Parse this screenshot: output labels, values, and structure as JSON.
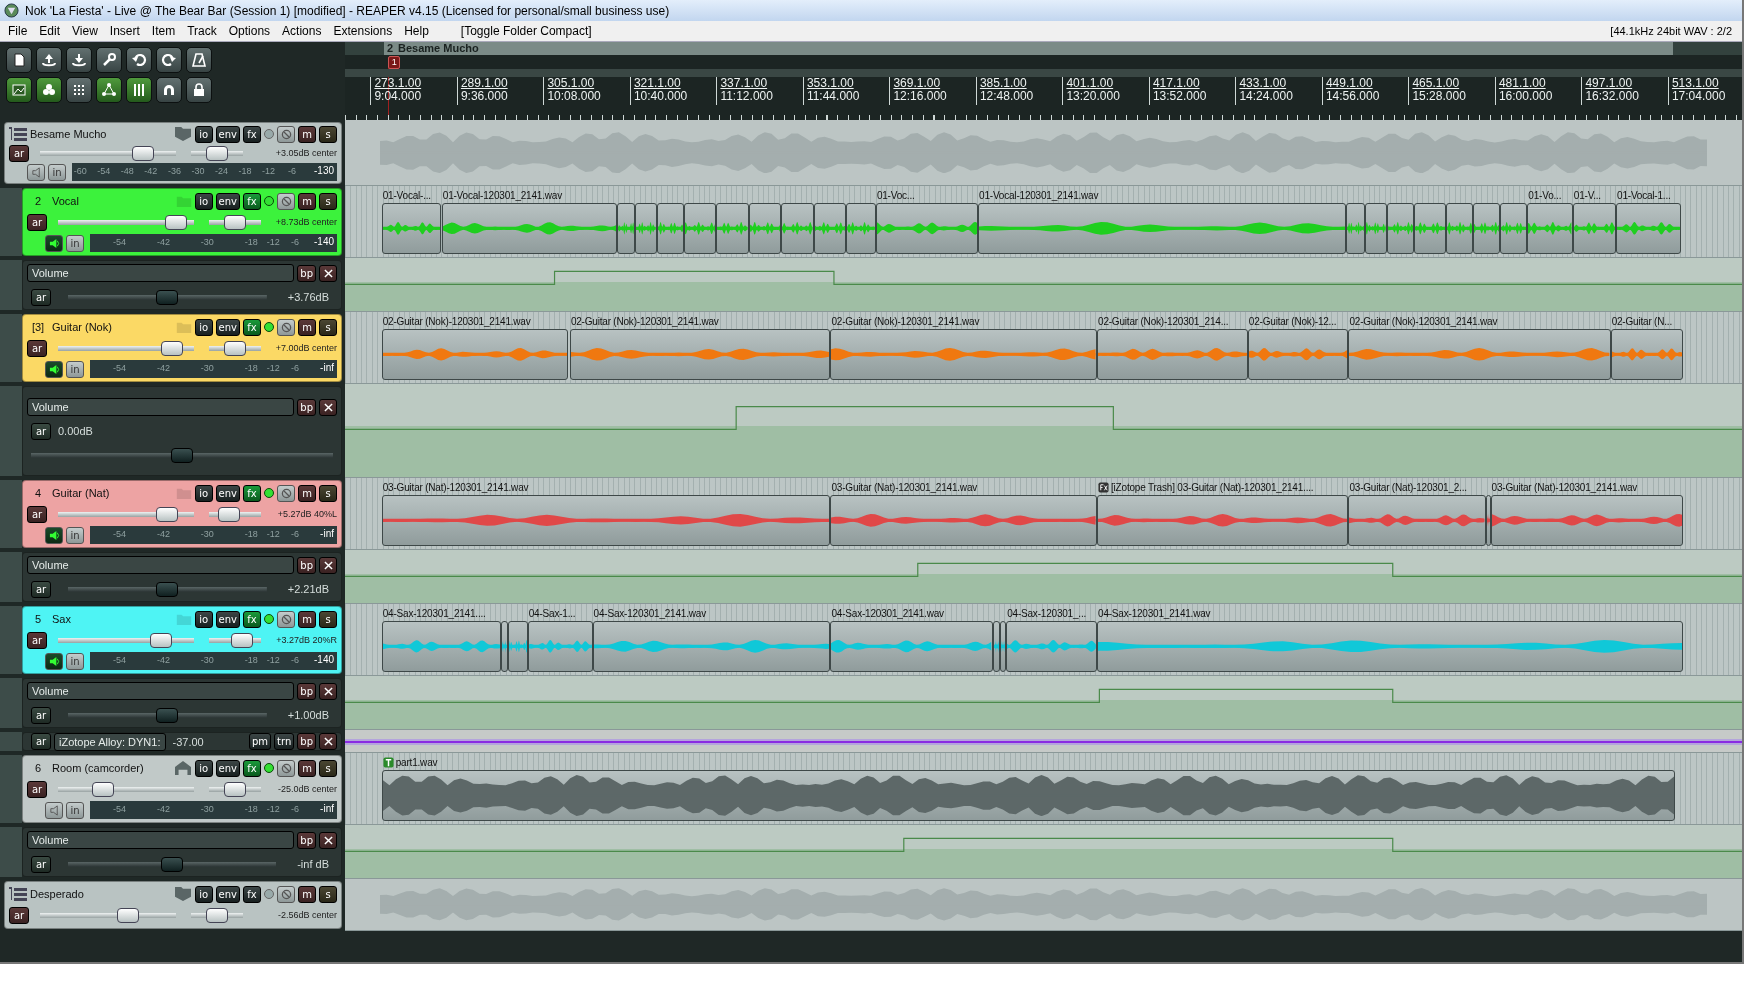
{
  "window": {
    "title": "Nok 'La Fiesta' - Live @ The Bear Bar (Session 1) [modified] - REAPER v4.15 (Licensed for personal/small business use)"
  },
  "menu": [
    {
      "label": "File"
    },
    {
      "label": "Edit"
    },
    {
      "label": "View"
    },
    {
      "label": "Insert"
    },
    {
      "label": "Item"
    },
    {
      "label": "Track"
    },
    {
      "label": "Options"
    },
    {
      "label": "Actions"
    },
    {
      "label": "Extensions"
    },
    {
      "label": "Help"
    },
    {
      "label": "[Toggle Folder Compact]"
    }
  ],
  "status": "[44.1kHz 24bit WAV : 2/2",
  "toolbar": [
    {
      "on": false
    },
    {
      "on": false
    },
    {
      "on": false
    },
    {
      "on": false
    },
    {
      "on": false
    },
    {
      "on": false
    },
    {
      "on": false
    },
    {
      "on": true
    },
    {
      "on": true
    },
    {
      "on": false
    },
    {
      "on": true
    },
    {
      "on": true
    },
    {
      "on": false
    },
    {
      "on": false
    }
  ],
  "ruler": {
    "region": {
      "number": "2",
      "name": "Besame Mucho"
    },
    "marker": {
      "label": "1"
    },
    "ticks": [
      {
        "bar": "273.1.00",
        "time": "9:04.000"
      },
      {
        "bar": "289.1.00",
        "time": "9:36.000"
      },
      {
        "bar": "305.1.00",
        "time": "10:08.000"
      },
      {
        "bar": "321.1.00",
        "time": "10:40.000"
      },
      {
        "bar": "337.1.00",
        "time": "11:12.000"
      },
      {
        "bar": "353.1.00",
        "time": "11:44.000"
      },
      {
        "bar": "369.1.00",
        "time": "12:16.000"
      },
      {
        "bar": "385.1.00",
        "time": "12:48.000"
      },
      {
        "bar": "401.1.00",
        "time": "13:20.000"
      },
      {
        "bar": "417.1.00",
        "time": "13:52.000"
      },
      {
        "bar": "433.1.00",
        "time": "14:24.000"
      },
      {
        "bar": "449.1.00",
        "time": "14:56.000"
      },
      {
        "bar": "465.1.00",
        "time": "15:28.000"
      },
      {
        "bar": "481.1.00",
        "time": "16:00.000"
      },
      {
        "bar": "497.1.00",
        "time": "16:32.000"
      },
      {
        "bar": "513.1.00",
        "time": "17:04.000"
      }
    ]
  },
  "tracks": [
    {
      "kind": "folder",
      "name": "Besame Mucho",
      "color": "#b9c3c2",
      "fx_active": false,
      "monitor": false,
      "volume": {
        "level": 0.76
      },
      "pan": {
        "level": 0.5
      },
      "readout": "+3.05dB center",
      "controls": {
        "arm": "ar",
        "io": "io",
        "env": "env",
        "fx": "fx",
        "mute": "m",
        "solo": "s",
        "input": "in"
      },
      "meter": {
        "scale": [
          "-60",
          "-54",
          "-48",
          "-42",
          "-36",
          "-30",
          "-24",
          "-18",
          "-12",
          "-6"
        ],
        "peak": "-130"
      },
      "children": [
        {
          "kind": "track",
          "number": "2",
          "name": "Vocal",
          "color": "#3cf23c",
          "fx_active": true,
          "monitor": true,
          "volume": {
            "level": 0.87
          },
          "pan": {
            "level": 0.5
          },
          "readout": "+8.73dB center",
          "controls": {
            "arm": "ar",
            "io": "io",
            "env": "env",
            "fx": "fx",
            "mute": "m",
            "solo": "s",
            "input": "in"
          },
          "meter": {
            "scale": [
              "-54",
              "-42",
              "-30",
              "-18",
              "-12",
              "-6"
            ],
            "peak": "-140"
          },
          "items": [
            {
              "kind": "audio",
              "label": "01-Vocal-..."
            },
            {
              "kind": "audio",
              "label": "01-Vocal-120301_2141.wav"
            },
            {
              "kind": "audio"
            },
            {
              "kind": "audio"
            },
            {
              "kind": "audio"
            },
            {
              "kind": "audio"
            },
            {
              "kind": "audio"
            },
            {
              "kind": "audio"
            },
            {
              "kind": "audio"
            },
            {
              "kind": "audio"
            },
            {
              "kind": "audio"
            },
            {
              "kind": "audio",
              "label": "01-Voc..."
            },
            {
              "kind": "audio",
              "label": "01-Vocal-120301_2141.wav"
            },
            {
              "kind": "audio"
            },
            {
              "kind": "audio"
            },
            {
              "kind": "audio"
            },
            {
              "kind": "audio"
            },
            {
              "kind": "audio"
            },
            {
              "kind": "audio"
            },
            {
              "kind": "audio"
            },
            {
              "kind": "audio",
              "label": "01-Vo..."
            },
            {
              "kind": "audio",
              "label": "01-V..."
            },
            {
              "kind": "audio",
              "label": "01-Vocal-1..."
            }
          ],
          "envelopes": [
            {
              "kind": "fader",
              "name": "Volume",
              "value": "+3.76dB",
              "level": 0.5,
              "controls": {
                "arm": "ar",
                "bypass": "bp"
              }
            }
          ]
        },
        {
          "kind": "track",
          "number": "[3]",
          "name": "Guitar (Nok)",
          "color": "#fbd965",
          "fx_active": true,
          "monitor": true,
          "volume": {
            "level": 0.84
          },
          "pan": {
            "level": 0.5
          },
          "readout": "+7.00dB center",
          "controls": {
            "arm": "ar",
            "io": "io",
            "env": "env",
            "fx": "fx",
            "mute": "m",
            "solo": "s",
            "input": "in"
          },
          "meter": {
            "scale": [
              "-54",
              "-42",
              "-30",
              "-18",
              "-12",
              "-6"
            ],
            "peak": "-inf"
          },
          "items": [
            {
              "kind": "audio",
              "label": "02-Guitar (Nok)-120301_2141.wav"
            },
            {
              "kind": "audio",
              "label": "02-Guitar (Nok)-120301_2141.wav"
            },
            {
              "kind": "audio",
              "label": "02-Guitar (Nok)-120301_2141.wav"
            },
            {
              "kind": "audio",
              "label": "02-Guitar (Nok)-120301_214..."
            },
            {
              "kind": "audio",
              "label": "02-Guitar (Nok)-12..."
            },
            {
              "kind": "audio",
              "label": "02-Guitar (Nok)-120301_2141.wav"
            },
            {
              "kind": "audio",
              "label": "02-Guitar (N..."
            }
          ],
          "envelopes": [
            {
              "kind": "fader_tall",
              "name": "Volume",
              "value": "0.00dB",
              "level": 0.5,
              "controls": {
                "arm": "ar",
                "bypass": "bp"
              }
            }
          ]
        },
        {
          "kind": "track",
          "number": "4",
          "name": "Guitar (Nat)",
          "color": "#eda3a3",
          "fx_active": true,
          "monitor": true,
          "volume": {
            "level": 0.8
          },
          "pan": {
            "level": 0.38
          },
          "readout": "+5.27dB 40%L",
          "controls": {
            "arm": "ar",
            "io": "io",
            "env": "env",
            "fx": "fx",
            "mute": "m",
            "solo": "s",
            "input": "in"
          },
          "meter": {
            "scale": [
              "-54",
              "-42",
              "-30",
              "-18",
              "-12",
              "-6"
            ],
            "peak": "-inf"
          },
          "items": [
            {
              "kind": "audio",
              "label": "03-Guitar (Nat)-120301_2141.wav"
            },
            {
              "kind": "audio",
              "label": "03-Guitar (Nat)-120301_2141.wav"
            },
            {
              "kind": "fx",
              "label": "[iZotope Trash] 03-Guitar (Nat)-120301_2141...."
            },
            {
              "kind": "audio",
              "label": "03-Guitar (Nat)-120301_2..."
            },
            {
              "kind": "audio"
            },
            {
              "kind": "audio",
              "label": "03-Guitar (Nat)-120301_2141.wav"
            }
          ],
          "envelopes": [
            {
              "kind": "fader",
              "name": "Volume",
              "value": "+2.21dB",
              "level": 0.5,
              "controls": {
                "arm": "ar",
                "bypass": "bp"
              }
            }
          ]
        },
        {
          "kind": "track",
          "number": "5",
          "name": "Sax",
          "color": "#4ef4f4",
          "fx_active": true,
          "monitor": true,
          "volume": {
            "level": 0.76
          },
          "pan": {
            "level": 0.63
          },
          "readout": "+3.27dB 20%R",
          "controls": {
            "arm": "ar",
            "io": "io",
            "env": "env",
            "fx": "fx",
            "mute": "m",
            "solo": "s",
            "input": "in"
          },
          "meter": {
            "scale": [
              "-54",
              "-42",
              "-30",
              "-18",
              "-12",
              "-6"
            ],
            "peak": "-140"
          },
          "items": [
            {
              "kind": "audio",
              "label": "04-Sax-120301_2141...."
            },
            {
              "kind": "audio"
            },
            {
              "kind": "audio"
            },
            {
              "kind": "audio",
              "label": "04-Sax-1..."
            },
            {
              "kind": "audio",
              "label": "04-Sax-120301_2141.wav"
            },
            {
              "kind": "audio",
              "label": "04-Sax-120301_2141.wav"
            },
            {
              "kind": "audio"
            },
            {
              "kind": "audio"
            },
            {
              "kind": "audio",
              "label": "04-Sax-120301_..."
            },
            {
              "kind": "audio",
              "label": "04-Sax-120301_2141.wav"
            }
          ],
          "envelopes": [
            {
              "kind": "fader",
              "name": "Volume",
              "value": "+1.00dB",
              "level": 0.5,
              "controls": {
                "arm": "ar",
                "bypass": "bp"
              }
            },
            {
              "kind": "fx_param",
              "name": "iZotope Alloy: DYN1:",
              "value": "-37.00",
              "controls": {
                "arm": "ar",
                "mode": "pm",
                "learn": "trn",
                "bypass": "bp"
              }
            }
          ]
        },
        {
          "kind": "folder_end",
          "number": "6",
          "name": "Room (camcorder)",
          "color": "#c1c9c8",
          "fx_active": true,
          "monitor": false,
          "volume": {
            "level": 0.33
          },
          "pan": {
            "level": 0.5
          },
          "readout": "-25.0dB center",
          "controls": {
            "arm": "ar",
            "io": "io",
            "env": "env",
            "fx": "fx",
            "mute": "m",
            "solo": "s",
            "input": "in"
          },
          "meter": {
            "scale": [
              "-54",
              "-42",
              "-30",
              "-18",
              "-12",
              "-6"
            ],
            "peak": "-inf"
          },
          "items": [
            {
              "kind": "take",
              "label": "part1.wav"
            }
          ],
          "envelopes": [
            {
              "kind": "fader",
              "name": "Volume",
              "value": "-inf dB",
              "level": 0.5,
              "controls": {
                "arm": "ar",
                "bypass": "bp"
              }
            }
          ]
        }
      ]
    },
    {
      "kind": "folder",
      "name": "Desperado",
      "color": "#b9c3c2",
      "fx_active": false,
      "volume": {
        "level": 0.65
      },
      "pan": {
        "level": 0.5
      },
      "readout": "-2.56dB center",
      "controls": {
        "arm": "ar",
        "io": "io",
        "env": "env",
        "fx": "fx",
        "mute": "m",
        "solo": "s"
      }
    }
  ]
}
